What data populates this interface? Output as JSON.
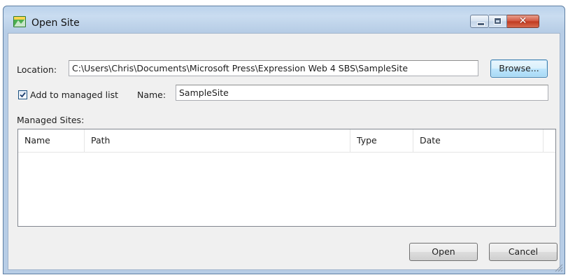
{
  "window": {
    "title": "Open Site",
    "icon": "expression-web-app-icon",
    "controls": [
      "minimize-icon",
      "maximize-icon",
      "close-icon"
    ]
  },
  "location": {
    "label": "Location:",
    "value": "C:\\Users\\Chris\\Documents\\Microsoft Press\\Expression Web 4 SBS\\SampleSite",
    "browse_label": "Browse..."
  },
  "managed": {
    "checkbox_label": "Add to managed list",
    "checked": true,
    "name_label": "Name:",
    "name_value": "SampleSite",
    "sites_label": "Managed Sites:",
    "columns": [
      "Name",
      "Path",
      "Type",
      "Date"
    ],
    "rows": []
  },
  "footer": {
    "open_label": "Open",
    "cancel_label": "Cancel"
  },
  "colors": {
    "title_bar": "#bcd3ec",
    "client_bg": "#f0f0f0",
    "close_button": "#c0391f",
    "focus_button": "#3c7fb1"
  }
}
